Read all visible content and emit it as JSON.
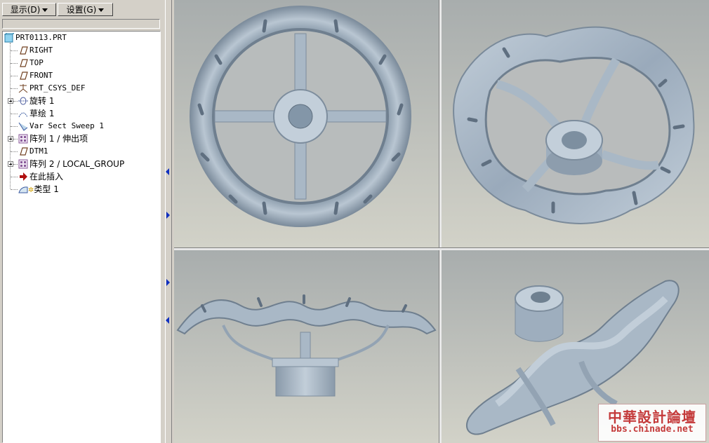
{
  "toolbar": {
    "display_label": "显示(D)",
    "settings_label": "设置(G)"
  },
  "model_tree": {
    "root": "PRT0113.PRT",
    "items": [
      {
        "label": "RIGHT",
        "icon": "datum-plane-icon",
        "expandable": false
      },
      {
        "label": "TOP",
        "icon": "datum-plane-icon",
        "expandable": false
      },
      {
        "label": "FRONT",
        "icon": "datum-plane-icon",
        "expandable": false
      },
      {
        "label": "PRT_CSYS_DEF",
        "icon": "csys-icon",
        "expandable": false
      },
      {
        "label": "旋转 1",
        "icon": "revolve-icon",
        "expandable": true
      },
      {
        "label": "草绘 1",
        "icon": "sketch-icon",
        "expandable": false
      },
      {
        "label": "Var Sect Sweep 1",
        "icon": "sweep-icon",
        "expandable": false
      },
      {
        "label": "阵列 1 / 伸出项",
        "icon": "pattern-icon",
        "expandable": true
      },
      {
        "label": "DTM1",
        "icon": "datum-plane-icon",
        "expandable": false
      },
      {
        "label": "阵列 2 / LOCAL_GROUP",
        "icon": "pattern-icon",
        "expandable": true
      },
      {
        "label": "在此插入",
        "icon": "insert-here-arrow-icon",
        "expandable": false
      },
      {
        "label": "类型 1",
        "icon": "style-surface-icon",
        "expandable": false
      }
    ]
  },
  "viewports": [
    "top-view",
    "isometric-view",
    "front-view",
    "perspective-view"
  ],
  "watermark": {
    "line1": "中華設計論壇",
    "line2": "bbs.chinade.net"
  },
  "colors": {
    "viewport_bg": "#b5b9b9",
    "model": "#9fb0c0",
    "watermark": "#c43a3a"
  }
}
